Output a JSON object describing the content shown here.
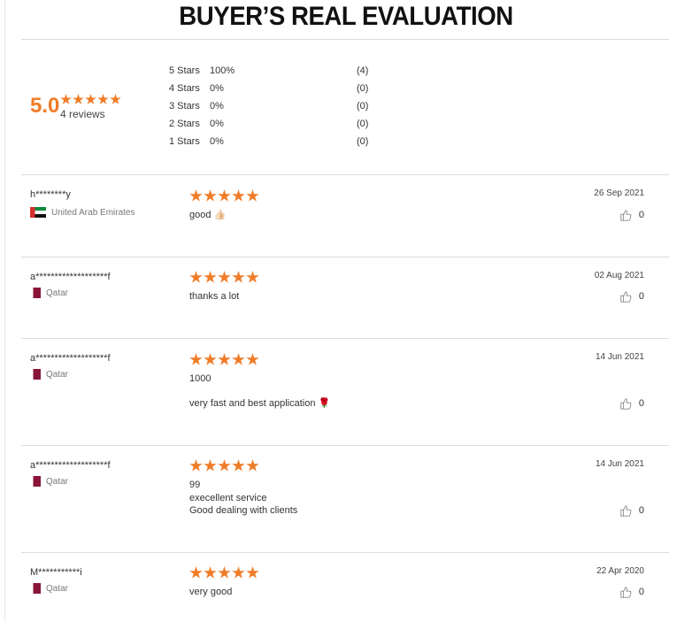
{
  "header": {
    "title": "BUYER’S REAL EVALUATION"
  },
  "summary": {
    "score": "5.0",
    "star_count": 5,
    "reviews_label": "4 reviews",
    "accent_color": "#f07c28",
    "distribution": [
      {
        "label": "5  Stars",
        "percent": "100%",
        "count": "(4)"
      },
      {
        "label": "4  Stars",
        "percent": "0%",
        "count": "(0)"
      },
      {
        "label": "3  Stars",
        "percent": "0%",
        "count": "(0)"
      },
      {
        "label": "2  Stars",
        "percent": "0%",
        "count": "(0)"
      },
      {
        "label": "1  Stars",
        "percent": "0%",
        "count": "(0)"
      }
    ]
  },
  "reviews": [
    {
      "user": "h********y",
      "country": "United Arab Emirates",
      "flag": "uae",
      "rating": 5,
      "text": "good 👍🏻",
      "date": "26 Sep 2021",
      "likes": "0"
    },
    {
      "user": "a*******************f",
      "country": "Qatar",
      "flag": "qatar",
      "rating": 5,
      "text": "thanks a lot",
      "date": "02 Aug 2021",
      "likes": "0"
    },
    {
      "user": "a*******************f",
      "country": "Qatar",
      "flag": "qatar",
      "rating": 5,
      "text": "1000",
      "text2": "very fast and best application 🌹",
      "date": "14 Jun 2021",
      "likes": "0"
    },
    {
      "user": "a*******************f",
      "country": "Qatar",
      "flag": "qatar",
      "rating": 5,
      "text": "99\nexecellent service\nGood dealing with clients",
      "date": "14 Jun 2021",
      "likes": "0"
    },
    {
      "user": "M***********i",
      "country": "Qatar",
      "flag": "qatar",
      "rating": 5,
      "text": "very good",
      "date": "22 Apr 2020",
      "likes": "0"
    }
  ]
}
